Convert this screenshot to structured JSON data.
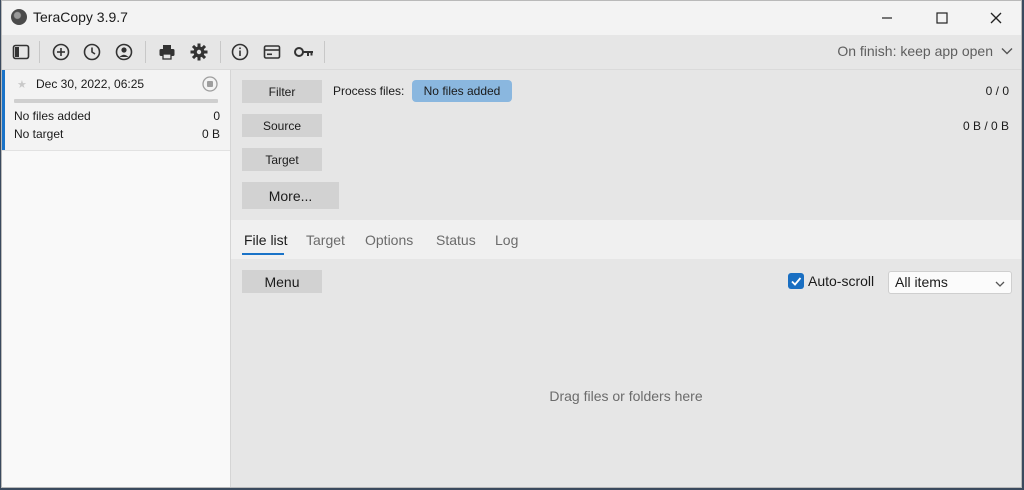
{
  "window": {
    "title": "TeraCopy 3.9.7"
  },
  "toolbar": {
    "icons": [
      "panel-toggle-icon",
      "add-icon",
      "history-icon",
      "profile-icon",
      "print-icon",
      "settings-icon",
      "info-icon",
      "card-icon",
      "key-icon"
    ],
    "on_finish": "On finish: keep app open"
  },
  "job": {
    "date": "Dec 30, 2022, 06:25",
    "files_label": "No files added",
    "files_value": "0",
    "target_label": "No target",
    "target_value": "0 B"
  },
  "actions": {
    "filter": "Filter",
    "source": "Source",
    "target": "Target",
    "more": "More...",
    "process_label": "Process files:",
    "process_value": "No files added",
    "count_files": "0 / 0",
    "count_bytes": "0 B / 0 B"
  },
  "tabs": {
    "items": [
      "File list",
      "Target",
      "Options",
      "Status",
      "Log"
    ],
    "active": "File list"
  },
  "filelist": {
    "menu": "Menu",
    "autoscroll": "Auto-scroll",
    "autoscroll_checked": true,
    "filter_select": "All items",
    "drop_hint": "Drag files or folders here"
  },
  "colors": {
    "accent": "#1a73c8",
    "badge": "#8ab7df"
  }
}
